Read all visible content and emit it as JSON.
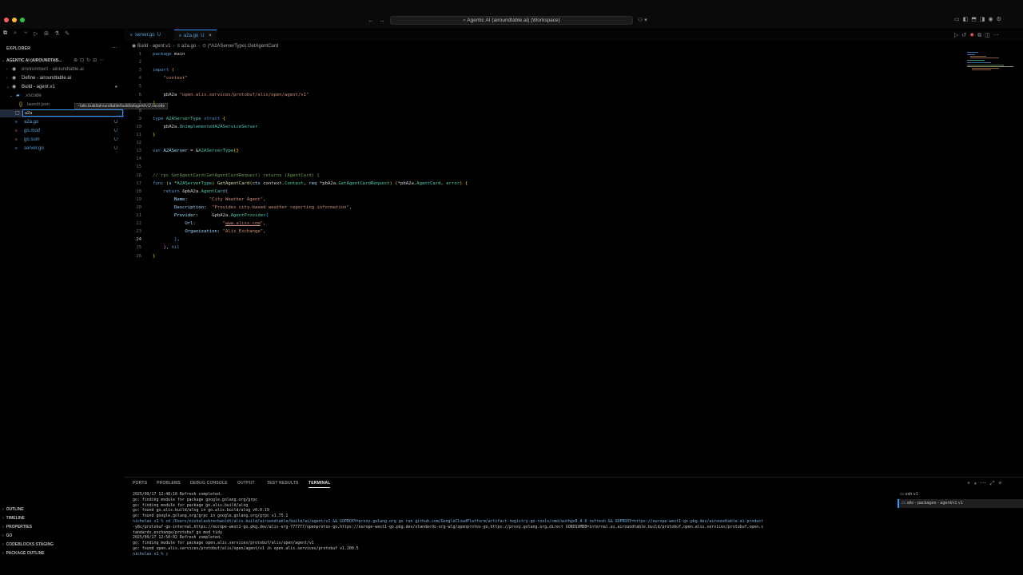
{
  "window": {
    "title": "Agentic AI (airoundtable.ai) (Workspace)",
    "traffic_colors": [
      "#ff5f57",
      "#febc2e",
      "#28c840"
    ]
  },
  "sidebar": {
    "explorer_title": "EXPLORER",
    "workspace_label": "AGENTIC AI (AIROUNDTAB...",
    "folders": [
      {
        "label": "environment - airoundtable.ai",
        "icon": "folder-icon"
      },
      {
        "label": "Define - airoundtable.ai",
        "icon": "folder-icon"
      },
      {
        "label": "Build - agent.v1",
        "icon": "folder-icon",
        "badge": "●"
      }
    ],
    "vscode_folder": ".vscode",
    "launch_file": "launch.json",
    "tooltip": "~/alis.build/airoundtable/build/ai/agent/v1/.vscode",
    "rename_value": "a2a",
    "files": [
      {
        "label": "a2a.go",
        "badge": "U"
      },
      {
        "label": "go.mod",
        "badge": "U"
      },
      {
        "label": "go.sum",
        "badge": "U"
      },
      {
        "label": "server.go",
        "badge": "U"
      }
    ],
    "bottom_sections": [
      "OUTLINE",
      "TIMELINE",
      "PROPERTIES",
      "GO",
      "CODEBLOCKS STAGING",
      "PACKAGE OUTLINE"
    ]
  },
  "tabs": [
    {
      "label": "server.go",
      "badge": "U",
      "active": false
    },
    {
      "label": "a2a.go",
      "badge": "U",
      "active": true
    }
  ],
  "breadcrumb": [
    "Build - agent.v1",
    "a2a.go",
    "(*A2AServerType).GetAgentCard"
  ],
  "code": {
    "current_line": 24,
    "lines": [
      {
        "n": "1",
        "t": [
          [
            "kw",
            "package"
          ],
          [
            "pl",
            " main"
          ]
        ]
      },
      {
        "n": "2",
        "t": []
      },
      {
        "n": "3",
        "t": [
          [
            "kw",
            "import"
          ],
          [
            "pl",
            " "
          ],
          [
            "br",
            "("
          ]
        ]
      },
      {
        "n": "4",
        "t": [
          [
            "pl",
            "    "
          ],
          [
            "str",
            "\"context\""
          ]
        ]
      },
      {
        "n": "5",
        "t": []
      },
      {
        "n": "6",
        "t": [
          [
            "pl",
            "    pbA2a "
          ],
          [
            "str",
            "\"open.alis.services/protobuf/alis/open/agent/v1\""
          ]
        ]
      },
      {
        "n": "7",
        "t": [
          [
            "br",
            ")"
          ]
        ]
      },
      {
        "n": "8",
        "t": []
      },
      {
        "n": "9",
        "t": [
          [
            "kw",
            "type"
          ],
          [
            "pl",
            " "
          ],
          [
            "typ",
            "A2AServerType"
          ],
          [
            "pl",
            " "
          ],
          [
            "kw",
            "struct"
          ],
          [
            "pl",
            " "
          ],
          [
            "br",
            "{"
          ]
        ]
      },
      {
        "n": "10",
        "t": [
          [
            "pl",
            "    pbA2a."
          ],
          [
            "typ",
            "UnimplementedA2AServiceServer"
          ]
        ]
      },
      {
        "n": "11",
        "t": [
          [
            "br",
            "}"
          ]
        ]
      },
      {
        "n": "12",
        "t": []
      },
      {
        "n": "13",
        "t": [
          [
            "kw",
            "var"
          ],
          [
            "pl",
            " "
          ],
          [
            "var",
            "A2AServer"
          ],
          [
            "pl",
            " = &"
          ],
          [
            "typ",
            "A2AServerType"
          ],
          [
            "br",
            "{}"
          ]
        ]
      },
      {
        "n": "14",
        "t": []
      },
      {
        "n": "15",
        "t": []
      },
      {
        "n": "16",
        "t": [
          [
            "cm",
            "// rpc GetAgentCard(GetAgentCardRequest) returns (AgentCard) {"
          ]
        ]
      },
      {
        "n": "17",
        "t": [
          [
            "kw",
            "func"
          ],
          [
            "pl",
            " "
          ],
          [
            "br",
            "("
          ],
          [
            "var",
            "s"
          ],
          [
            "pl",
            " *"
          ],
          [
            "typ",
            "A2AServerType"
          ],
          [
            "br",
            ")"
          ],
          [
            "pl",
            " "
          ],
          [
            "fn",
            "GetAgentCard"
          ],
          [
            "br",
            "("
          ],
          [
            "var",
            "ctx"
          ],
          [
            "pl",
            " context."
          ],
          [
            "typ",
            "Context"
          ],
          [
            "pl",
            ", "
          ],
          [
            "var",
            "req"
          ],
          [
            "pl",
            " *pbA2a."
          ],
          [
            "typ",
            "GetAgentCardRequest"
          ],
          [
            "br",
            ")"
          ],
          [
            "pl",
            " "
          ],
          [
            "br",
            "("
          ],
          [
            "pl",
            "*pbA2a."
          ],
          [
            "typ",
            "AgentCard"
          ],
          [
            "pl",
            ", "
          ],
          [
            "typ",
            "error"
          ],
          [
            "br",
            ")"
          ],
          [
            "pl",
            " "
          ],
          [
            "br",
            "{"
          ]
        ]
      },
      {
        "n": "18",
        "t": [
          [
            "pl",
            "    "
          ],
          [
            "kw",
            "return"
          ],
          [
            "pl",
            " &pbA2a."
          ],
          [
            "typ",
            "AgentCard"
          ],
          [
            "br2",
            "{"
          ]
        ]
      },
      {
        "n": "19",
        "t": [
          [
            "pl",
            "        "
          ],
          [
            "var",
            "Name"
          ],
          [
            "pl",
            ":        "
          ],
          [
            "str",
            "\"City Weather Agent\""
          ],
          [
            "pl",
            ","
          ]
        ]
      },
      {
        "n": "20",
        "t": [
          [
            "pl",
            "        "
          ],
          [
            "var",
            "Description"
          ],
          [
            "pl",
            ":  "
          ],
          [
            "str",
            "\"Provides city-based weather reporting information\""
          ],
          [
            "pl",
            ","
          ]
        ]
      },
      {
        "n": "21",
        "t": [
          [
            "pl",
            "        "
          ],
          [
            "var",
            "Provider"
          ],
          [
            "pl",
            ":     &pbA2a."
          ],
          [
            "typ",
            "AgentProvider"
          ],
          [
            "br3",
            "{"
          ]
        ]
      },
      {
        "n": "22",
        "t": [
          [
            "pl",
            "            "
          ],
          [
            "var",
            "Url"
          ],
          [
            "pl",
            ":          "
          ],
          [
            "str",
            "\""
          ],
          [
            "lnk",
            "www.alisx.com"
          ],
          [
            "str",
            "\""
          ],
          [
            "pl",
            ","
          ]
        ]
      },
      {
        "n": "23",
        "t": [
          [
            "pl",
            "            "
          ],
          [
            "var",
            "Organization"
          ],
          [
            "pl",
            ": "
          ],
          [
            "str",
            "\"Alis Exchange\""
          ],
          [
            "pl",
            ","
          ]
        ]
      },
      {
        "n": "24",
        "t": [
          [
            "pl",
            "        "
          ],
          [
            "br3",
            "}"
          ],
          [
            "pl",
            ","
          ]
        ]
      },
      {
        "n": "25",
        "t": [
          [
            "pl",
            "    "
          ],
          [
            "br2",
            "}"
          ],
          [
            "pl",
            ", "
          ],
          [
            "kw",
            "nil"
          ]
        ]
      },
      {
        "n": "26",
        "t": [
          [
            "br",
            "}"
          ]
        ]
      }
    ]
  },
  "panel": {
    "tabs": [
      {
        "label": "PORTS",
        "active": false
      },
      {
        "label": "PROBLEMS",
        "active": false
      },
      {
        "label": "DEBUG CONSOLE",
        "active": false
      },
      {
        "label": "OUTPUT",
        "active": false
      },
      {
        "label": "TEST RESULTS",
        "active": false
      },
      {
        "label": "TERMINAL",
        "active": true
      }
    ],
    "terminal_lines": [
      "2025/09/17 12:48:18 Refresh completed.",
      "go: finding module for package google.golang.org/grpc",
      "go: finding module for package go.alis.build/alog",
      "go: found go.alis.build/alog in go.alis.build/alog v0.0.19",
      "go: found google.golang.org/grpc in google.golang.org/grpc v1.75.1",
      "nicholas v1 % cd /Users/nicholasbreckwoldt/alis.build/airoundtable/build/ai/agent/v1 && GOPROXY=proxy.golang.org go run github.com/GoogleCloudPlatform/artifact-registry-go-tools/cmd/auth@v0.4.0 refresh && GOPROXY=https://europe-west1-go.pkg.dev/airoundtable-ai-product",
      "-y8c/protobuf-go-internal,https://europe-west1-go.pkg.dev/alis-org-777777/openprotos-go,https://europe-west1-go.pkg.dev/standards-org-wlg/openprotos-go,https://proxy.golang.org,direct GONOSUMDB=internal.ai.airoundtable.build/protobuf,open.alis.services/protobuf,open.s",
      "tandards.exchange/protobuf go mod tidy",
      "2025/09/17 12:50:02 Refresh completed.",
      "go: finding module for package open.alis.services/protobuf/alis/open/agent/v1",
      "go: found open.alis.services/protobuf/alis/open/agent/v1 in open.alis.services/protobuf v1.200.5",
      "nicholas v1 % ▯"
    ],
    "terminals": [
      {
        "label": "zsh  v1",
        "active": false
      },
      {
        "label": "alis - packages - agent/v1  v1",
        "active": true
      }
    ]
  }
}
